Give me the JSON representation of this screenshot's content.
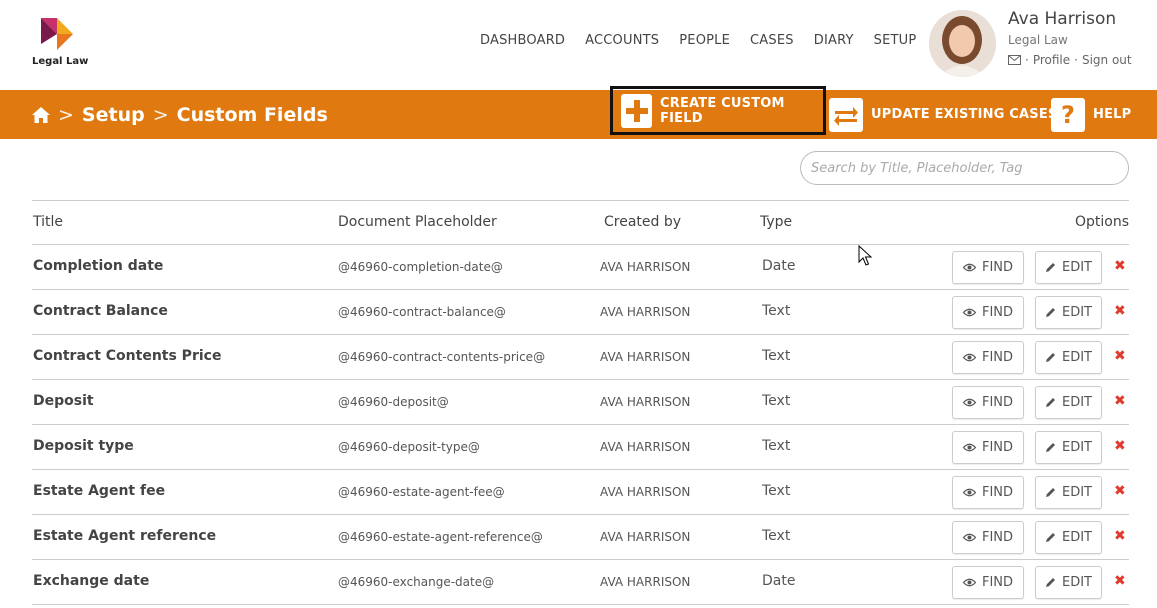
{
  "brand": {
    "logo_text": "Legal Law"
  },
  "nav": [
    "DASHBOARD",
    "ACCOUNTS",
    "PEOPLE",
    "CASES",
    "DIARY",
    "SETUP"
  ],
  "user": {
    "name": "Ava Harrison",
    "org": "Legal Law",
    "profile": "Profile",
    "sep": "·",
    "signout": "Sign out"
  },
  "breadcrumb": {
    "sep": ">",
    "setup": "Setup",
    "current": "Custom Fields"
  },
  "actions": {
    "create": "CREATE CUSTOM FIELD",
    "update": "UPDATE EXISTING CASES",
    "help": "HELP"
  },
  "search": {
    "placeholder": "Search by Title, Placeholder, Tag"
  },
  "table": {
    "headers": {
      "title": "Title",
      "placeholder": "Document Placeholder",
      "created_by": "Created by",
      "type": "Type",
      "options": "Options"
    },
    "find_label": "FIND",
    "edit_label": "EDIT",
    "delete_glyph": "✖",
    "rows": [
      {
        "title": "Completion date",
        "placeholder": "@46960-completion-date@",
        "created_by": "AVA HARRISON",
        "type": "Date"
      },
      {
        "title": "Contract Balance",
        "placeholder": "@46960-contract-balance@",
        "created_by": "AVA HARRISON",
        "type": "Text"
      },
      {
        "title": "Contract Contents Price",
        "placeholder": "@46960-contract-contents-price@",
        "created_by": "AVA HARRISON",
        "type": "Text"
      },
      {
        "title": "Deposit",
        "placeholder": "@46960-deposit@",
        "created_by": "AVA HARRISON",
        "type": "Text"
      },
      {
        "title": "Deposit type",
        "placeholder": "@46960-deposit-type@",
        "created_by": "AVA HARRISON",
        "type": "Text"
      },
      {
        "title": "Estate Agent fee",
        "placeholder": "@46960-estate-agent-fee@",
        "created_by": "AVA HARRISON",
        "type": "Text"
      },
      {
        "title": "Estate Agent reference",
        "placeholder": "@46960-estate-agent-reference@",
        "created_by": "AVA HARRISON",
        "type": "Text"
      },
      {
        "title": "Exchange date",
        "placeholder": "@46960-exchange-date@",
        "created_by": "AVA HARRISON",
        "type": "Date"
      }
    ]
  },
  "colors": {
    "accent": "#e07a10",
    "delete": "#e03a2f"
  }
}
